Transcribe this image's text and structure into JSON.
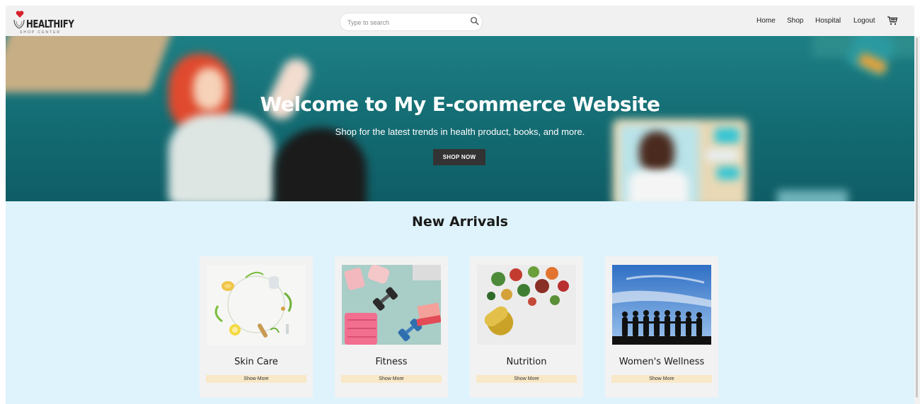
{
  "header": {
    "brand": "HEALTHIFY",
    "brand_sub": "SHOP CENTER",
    "search_placeholder": "Type to search",
    "nav": [
      "Home",
      "Shop",
      "Hospital",
      "Logout"
    ]
  },
  "hero": {
    "title": "Welcome to My E-commerce Website",
    "subtitle": "Shop for the latest trends in health product, books, and more.",
    "cta": "SHOP NOW"
  },
  "arrivals": {
    "heading": "New Arrivals",
    "cards": [
      {
        "name": "Skin Care",
        "button": "Show More"
      },
      {
        "name": "Fitness",
        "button": "Show More"
      },
      {
        "name": "Nutrition",
        "button": "Show More"
      },
      {
        "name": "Women's Wellness",
        "button": "Show More"
      }
    ]
  },
  "colors": {
    "hero_teal": "#136b72",
    "section_bg": "#dff3fc",
    "card_bg": "#f2f2f2",
    "show_more_bg": "#f8e8c7",
    "cta_bg": "#333333"
  },
  "icons": [
    "heart-logo-icon",
    "search-icon",
    "cart-icon"
  ]
}
